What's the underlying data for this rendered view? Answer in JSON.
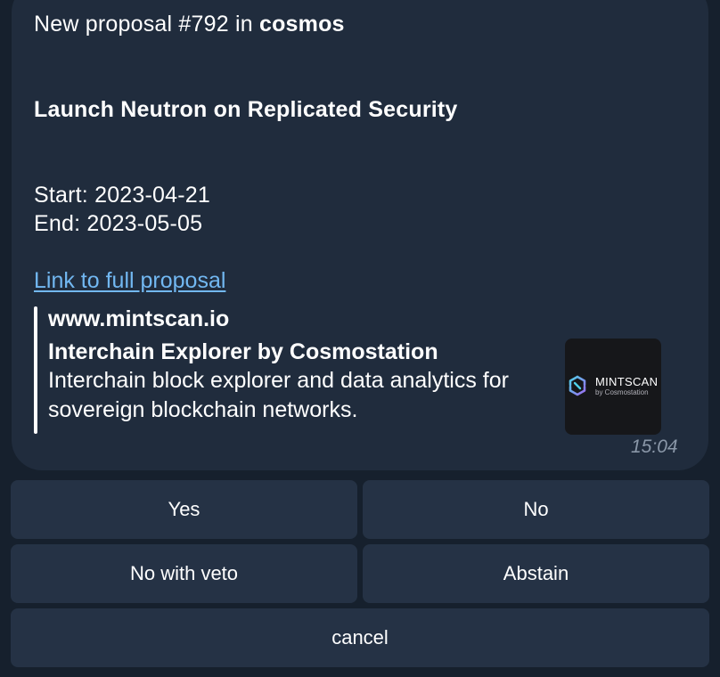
{
  "message": {
    "header_prefix": "New proposal #792 in ",
    "header_chain": "cosmos",
    "title": "Launch Neutron on Replicated Security",
    "start": "Start: 2023-04-21",
    "end": "End: 2023-05-05",
    "link_text": "Link to full proposal",
    "time": "15:04"
  },
  "preview": {
    "site": "www.mintscan.io",
    "title": "Interchain Explorer by Cosmostation",
    "description_line1": "Interchain block explorer and data analytics for",
    "description_line2": "sovereign blockchain networks.",
    "thumbnail": {
      "brand": "MINTSCAN",
      "brand_sub": "by Cosmostation",
      "icon": "mintscan-logo-icon",
      "colors": [
        "#4fd1e8",
        "#9b6cf0"
      ]
    }
  },
  "keyboard": {
    "yes": "Yes",
    "no": "No",
    "no_with_veto": "No with veto",
    "abstain": "Abstain",
    "cancel": "cancel"
  },
  "colors": {
    "background": "#16202d",
    "bubble": "#202c3d",
    "button": "#253245",
    "link": "#72b8f2",
    "timestamp": "#8a97a8"
  }
}
